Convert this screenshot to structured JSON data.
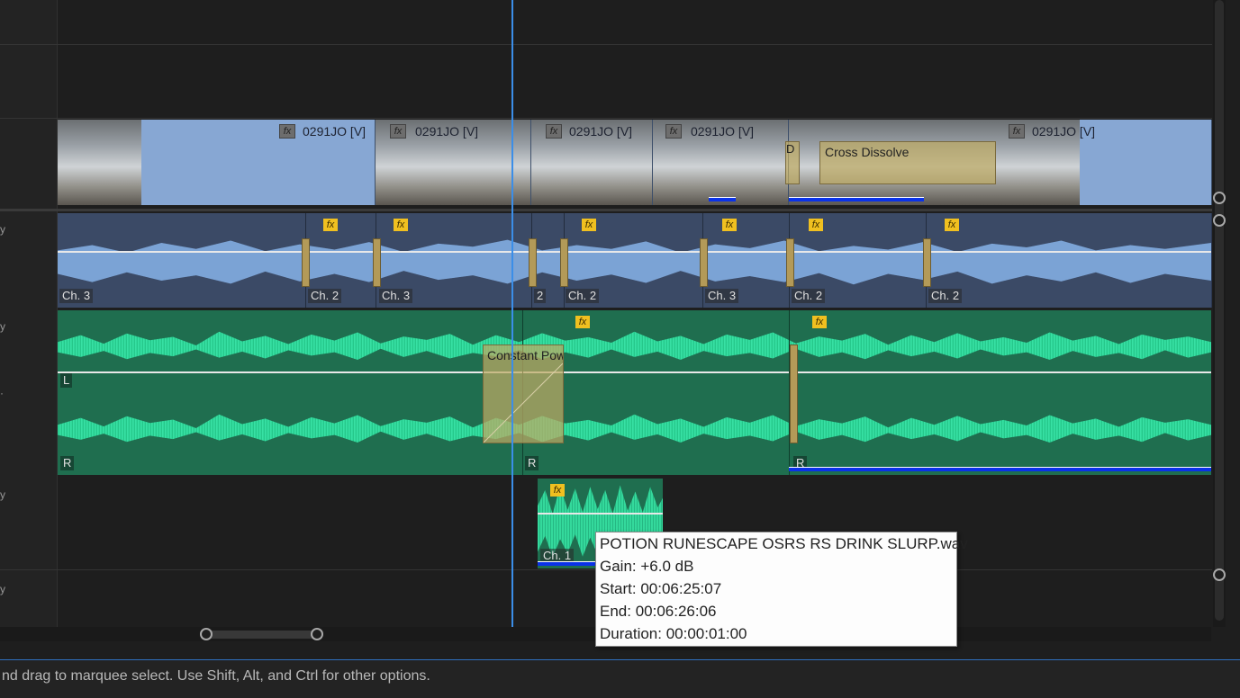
{
  "timeline": {
    "video_track": {
      "clips": [
        {
          "label": "0291JO [V]"
        },
        {
          "label": "0291JO [V]"
        },
        {
          "label": "0291JO [V]"
        },
        {
          "label": "0291JO [V]"
        },
        {
          "label": "0291JO [V]"
        }
      ],
      "fx_label": "fx",
      "transition_label": "Cross Dissolve",
      "transition_short": "D"
    },
    "audio1": {
      "fx_label": "fx",
      "channels": [
        "Ch. 3",
        "Ch. 2",
        "Ch. 3",
        "2",
        "Ch. 2",
        "Ch. 3",
        "Ch. 2",
        "Ch. 2"
      ]
    },
    "audio2": {
      "fx_label": "fx",
      "transition_label": "Constant Pow",
      "left_label": "L",
      "right_label": "R"
    },
    "audio3": {
      "fx_label": "fx",
      "channel": "Ch. 1"
    }
  },
  "tooltip": {
    "filename": "POTION RUNESCAPE OSRS RS DRINK SLURP.wav",
    "gain": "Gain: +6.0 dB",
    "start": "Start: 00:06:25:07",
    "end": "End: 00:06:26:06",
    "duration": "Duration: 00:00:01:00"
  },
  "status_bar": {
    "text": "nd drag to marquee select. Use Shift, Alt, and Ctrl for other options."
  },
  "colors": {
    "video_clip": "#87a7d3",
    "audio_blue": "#3b4a66",
    "audio_green": "#1f6e4f",
    "playhead": "#3b8ee8",
    "fx_badge": "#f0c020"
  }
}
